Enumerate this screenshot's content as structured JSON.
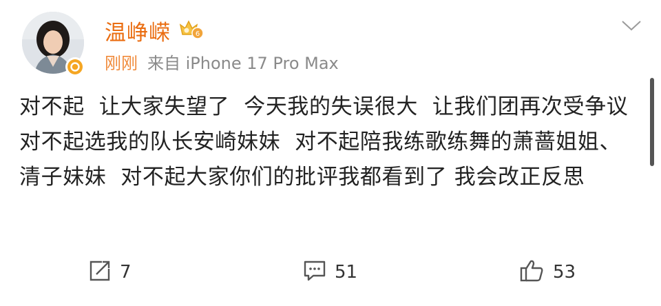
{
  "header": {
    "username": "温峥嵘",
    "time": "刚刚",
    "source": "来自 iPhone 17 Pro Max"
  },
  "post": {
    "text": "对不起  让大家失望了  今天我的失误很大  让我们团再次受争议  对不起选我的队长安崎妹妹  对不起陪我练歌练舞的萧蔷姐姐、清子妹妹  对不起大家你们的批评我都看到了 我会改正反思"
  },
  "actions": {
    "repost_count": "7",
    "comment_count": "51",
    "like_count": "53"
  },
  "icons": {
    "level_badge": "vip-level-badge-icon",
    "verified": "verified-badge-icon",
    "more": "chevron-down-icon",
    "repost": "repost-icon",
    "comment": "comment-icon",
    "like": "thumbs-up-icon"
  },
  "colors": {
    "username": "#ea6d11",
    "time": "#f08a3a",
    "verified": "#f5a623"
  }
}
